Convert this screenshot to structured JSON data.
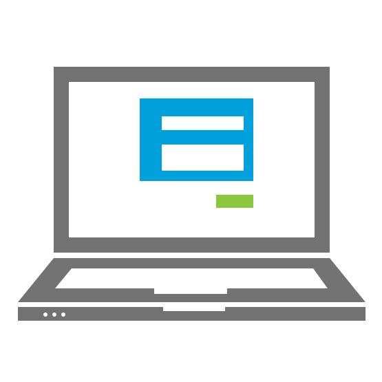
{
  "illustration": {
    "icon": "laptop-login-form-icon",
    "colors": {
      "background": "#ffffff",
      "frame": "#727272",
      "screen": "#ffffff",
      "form_panel": "#00a0dc",
      "form_field": "#ffffff",
      "submit_button": "#8cc63f",
      "led": "#ffffff"
    },
    "form": {
      "field_count": 2,
      "has_submit_button": true
    },
    "status_led_count": 3
  }
}
